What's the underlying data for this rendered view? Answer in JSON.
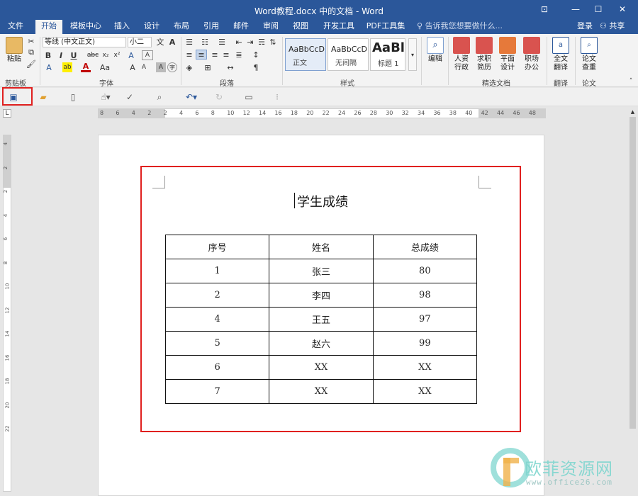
{
  "window": {
    "title": "Word教程.docx 中的文档 - Word",
    "controls": [
      "⊡",
      "—",
      "☐",
      "✕"
    ]
  },
  "tabs": [
    "文件",
    "开始",
    "模板中心",
    "插入",
    "设计",
    "布局",
    "引用",
    "邮件",
    "审阅",
    "视图",
    "开发工具",
    "PDF工具集"
  ],
  "active_tab": "开始",
  "tell_me": "告诉我您想要做什么...",
  "login": "登录",
  "share": "共享",
  "ribbon": {
    "clipboard": {
      "paste": "粘贴",
      "label": "剪贴板"
    },
    "font": {
      "family": "等线 (中文正文)",
      "size": "小二",
      "label": "字体"
    },
    "paragraph": {
      "label": "段落"
    },
    "styles": {
      "label": "样式",
      "items": [
        {
          "preview": "AaBbCcD",
          "name": "正文"
        },
        {
          "preview": "AaBbCcD",
          "name": "无间隔"
        },
        {
          "preview": "AaBl",
          "name": "标题 1"
        }
      ]
    },
    "editing": {
      "label": "编辑"
    },
    "docs": {
      "label": "精选文档",
      "items": [
        {
          "line1": "人资",
          "line2": "行政"
        },
        {
          "line1": "求职",
          "line2": "简历"
        },
        {
          "line1": "平面",
          "line2": "设计"
        },
        {
          "line1": "职场",
          "line2": "办公"
        }
      ]
    },
    "translate": {
      "line1": "全文",
      "line2": "翻译",
      "label": "翻译"
    },
    "paper": {
      "line1": "论文",
      "line2": "查重",
      "label": "论文"
    }
  },
  "ruler": {
    "h_ticks": [
      "8",
      "6",
      "4",
      "2",
      "2",
      "4",
      "6",
      "8",
      "10",
      "12",
      "14",
      "16",
      "18",
      "20",
      "22",
      "24",
      "26",
      "28",
      "30",
      "32",
      "34",
      "36",
      "38",
      "40",
      "42",
      "44",
      "46",
      "48"
    ],
    "v_ticks": [
      "4",
      "2",
      "2",
      "4",
      "6",
      "8",
      "10",
      "12",
      "14",
      "16",
      "18",
      "20",
      "22"
    ]
  },
  "document": {
    "title": "学生成绩",
    "table": {
      "headers": [
        "序号",
        "姓名",
        "总成绩"
      ],
      "rows": [
        [
          "1",
          "张三",
          "80"
        ],
        [
          "2",
          "李四",
          "98"
        ],
        [
          "4",
          "王五",
          "97"
        ],
        [
          "5",
          "赵六",
          "99"
        ],
        [
          "6",
          "XX",
          "XX"
        ],
        [
          "7",
          "XX",
          "XX"
        ]
      ]
    }
  },
  "watermark": {
    "cn": "欧菲资源网",
    "en": "www.office26.com"
  },
  "colors": {
    "titlebar": "#2b579a",
    "highlight": "#e0201f",
    "ribbon": "#f3f3f3"
  }
}
